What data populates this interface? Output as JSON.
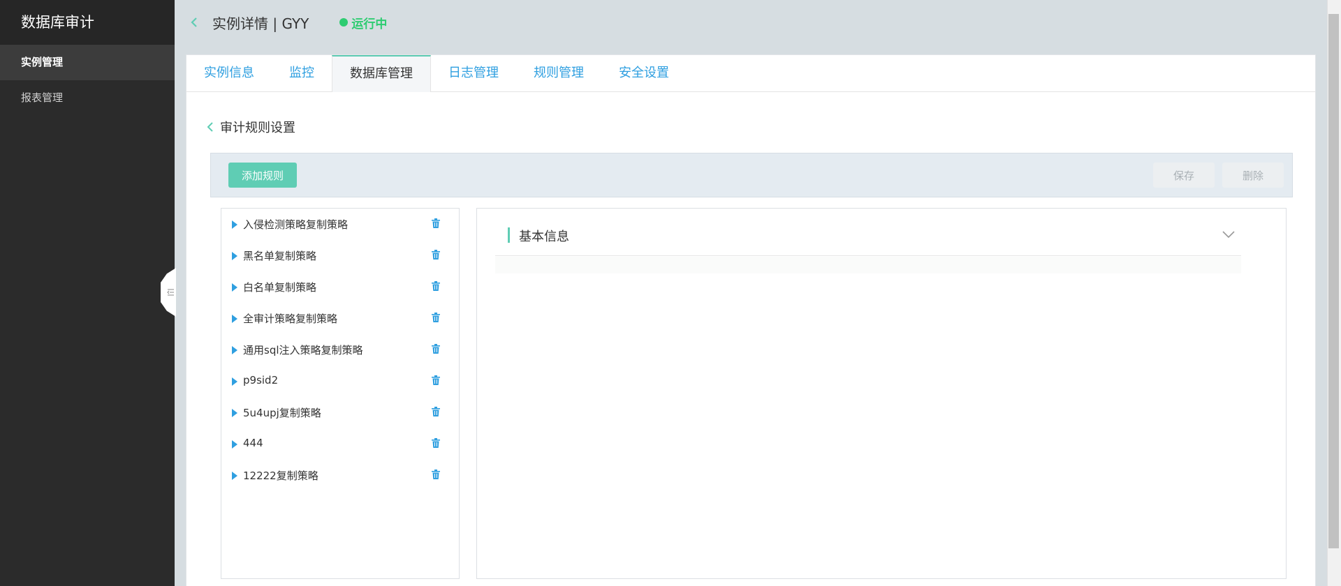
{
  "sidebar": {
    "brand": "数据库审计",
    "items": [
      {
        "label": "实例管理",
        "active": true
      },
      {
        "label": "报表管理",
        "active": false
      }
    ]
  },
  "header": {
    "title": "实例详情 | GYY",
    "status": "运行中",
    "status_color": "#2ecc71"
  },
  "tabs": [
    {
      "label": "实例信息",
      "active": false
    },
    {
      "label": "监控",
      "active": false
    },
    {
      "label": "数据库管理",
      "active": true
    },
    {
      "label": "日志管理",
      "active": false
    },
    {
      "label": "规则管理",
      "active": false
    },
    {
      "label": "安全设置",
      "active": false
    }
  ],
  "section": {
    "title": "审计规则设置"
  },
  "toolbar": {
    "add_label": "添加规则",
    "save_label": "保存",
    "delete_label": "删除"
  },
  "rules": [
    {
      "label": "入侵检测策略复制策略"
    },
    {
      "label": "黑名单复制策略"
    },
    {
      "label": "白名单复制策略"
    },
    {
      "label": "全审计策略复制策略"
    },
    {
      "label": "通用sql注入策略复制策略"
    },
    {
      "label": "p9sid2"
    },
    {
      "label": "5u4upj复制策略"
    },
    {
      "label": "444"
    },
    {
      "label": "12222复制策略"
    }
  ],
  "detail": {
    "section_title": "基本信息"
  },
  "icons": {
    "back": "chevron-left-icon",
    "rule_expand": "caret-right-icon",
    "rule_delete": "trash-icon",
    "collapse": "chevron-down-icon",
    "sidebar_toggle": "collapse-sidebar-icon"
  },
  "colors": {
    "accent": "#5fcdb4",
    "link": "#2f9fe0",
    "sidebar_bg": "#2b2b2b",
    "running": "#2ecc71"
  }
}
